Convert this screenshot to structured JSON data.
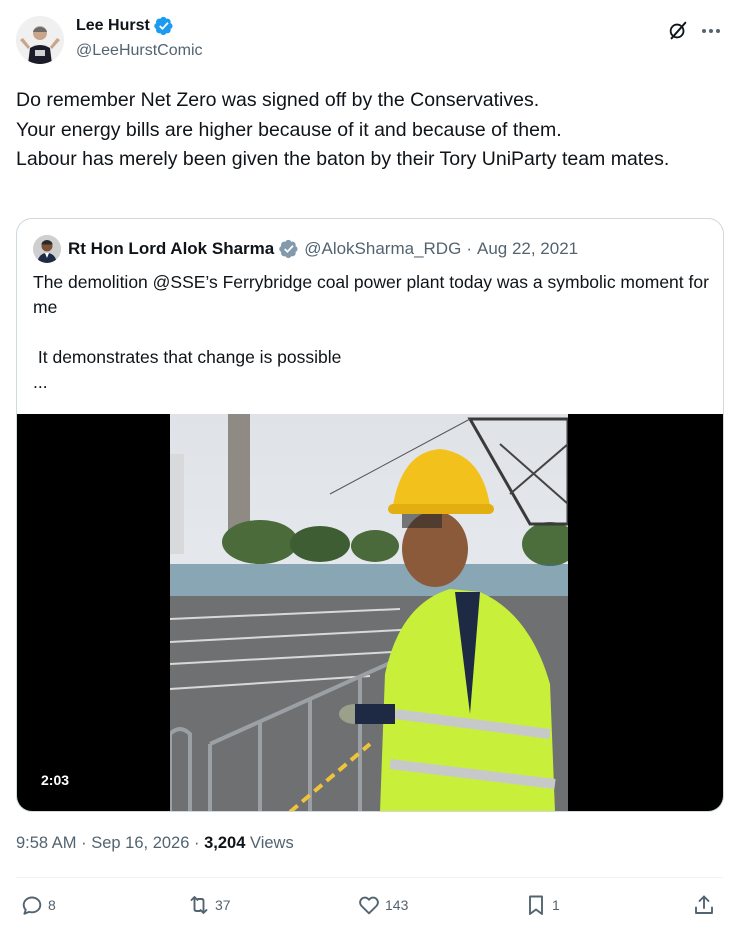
{
  "author": {
    "display_name": "Lee Hurst",
    "handle": "@LeeHurstComic",
    "verified": true,
    "verified_color": "#1d9bf0"
  },
  "tweet": {
    "text": "Do remember Net Zero was signed off by the Conservatives.\nYour energy bills are higher because of it and because of them.\nLabour has merely been given the baton by their Tory UniParty team mates."
  },
  "quote": {
    "display_name": "Rt Hon Lord Alok Sharma",
    "handle": "@AlokSharma_RDG",
    "separator": "·",
    "date": "Aug 22, 2021",
    "text": "The demolition @SSE’s Ferrybridge coal power plant today was a symbolic moment for me\n\n It demonstrates that change is possible\n...",
    "video_duration": "2:03"
  },
  "meta": {
    "time": "9:58 AM",
    "separator": "·",
    "date": "Sep 16, 2026",
    "views_count": "3,204",
    "views_label": "Views"
  },
  "actions": {
    "replies": "8",
    "reposts": "37",
    "likes": "143",
    "bookmarks": "1"
  },
  "icons": [
    "verified-badge-icon",
    "grok-icon",
    "more-icon",
    "reply-icon",
    "repost-icon",
    "like-icon",
    "bookmark-icon",
    "share-icon"
  ],
  "colors": {
    "text_primary": "#0f1419",
    "text_secondary": "#536471",
    "border": "#cfd9de",
    "accent": "#1d9bf0"
  }
}
